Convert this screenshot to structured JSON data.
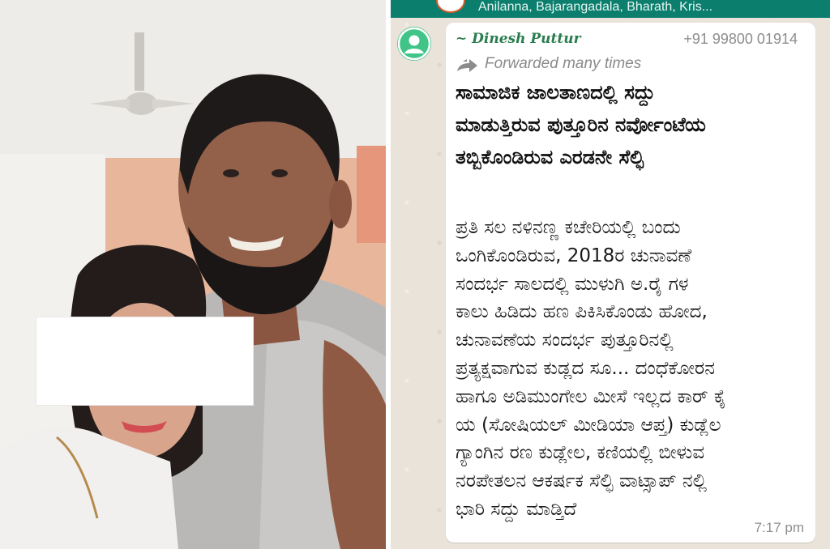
{
  "chat_header": {
    "members_text": "Anilanna, Bajarangadala, Bharath, Kris..."
  },
  "message": {
    "sender_name": "~ Dinesh Puttur",
    "sender_phone": "+91 99800 01914",
    "forwarded_label": "Forwarded many times",
    "headline_lines": [
      "ಸಾಮಾಜಿಕ ಜಾಲತಾಣದಲ್ಲಿ ಸದ್ದು",
      "ಮಾಡುತ್ತಿರುವ  ಪುತ್ತೂರಿನ ನರ್ವೋಂಟೆಯ",
      "ತಬ್ಬಿಕೊಂಡಿರುವ ಎರಡನೇ ಸೆಲ್ಫಿ"
    ],
    "body_lines": [
      "ಪ್ರತಿ ಸಲ ನಳಿನಣ್ಣ ಕಚೇರಿಯಲ್ಲಿ ಬಂದು",
      "ಒಂಗಿಕೊಂಡಿರುವ, 2018ರ ಚುನಾವಣೆ",
      "ಸಂದರ್ಭ ಸಾಲದಲ್ಲಿ ಮುಳುಗಿ ಅ.ರೈ ಗಳ",
      "ಕಾಲು ಹಿಡಿದು ಹಣ ಪಿಕಿಸಿಕೊಂಡು ಹೋದ,",
      "ಚುನಾವಣೆಯ ಸಂದರ್ಭ ಪುತ್ತೂರಿನಲ್ಲಿ",
      "ಪ್ರತ್ಯಕ್ಷವಾಗುವ ಕುಡ್ಲದ ಸೂ... ದಂಧೆಕೋರನ",
      "ಹಾಗೂ ಅಡಿಮುಂಗೇಲ ಮೀಸೆ ಇಲ್ಲದ ಕಾರ್ ಕೈ",
      "ಯ (ಸೋಷಿಯಲ್ ಮೀಡಿಯಾ ಆಪ್ತ)  ಕುಡ್ಲೆಲ",
      "ಗ್ಯಾಂಗಿನ ರಣ ಕುಡ್ಲೇಲ, ಕಣಿಯಲ್ಲಿ ಬೀಳುವ",
      "ನರಪೇತಲನ ಆಕರ್ಷಕ ಸೆಲ್ಫಿ ವಾಟ್ಸಾಪ್ ನಲ್ಲಿ",
      "ಭಾರಿ ಸದ್ದು ಮಾಡ್ತಿದೆ"
    ],
    "time": "7:17 pm"
  },
  "icons": {
    "sender_avatar": "default-user-icon",
    "forwarded": "forward-arrow-icon",
    "group_avatar": "group-avatar-icon"
  },
  "colors": {
    "whatsapp_header": "#0b7e6e",
    "sender_name": "#2a7d4f",
    "avatar_green": "#41c488",
    "chat_background": "#e9e3d9"
  }
}
